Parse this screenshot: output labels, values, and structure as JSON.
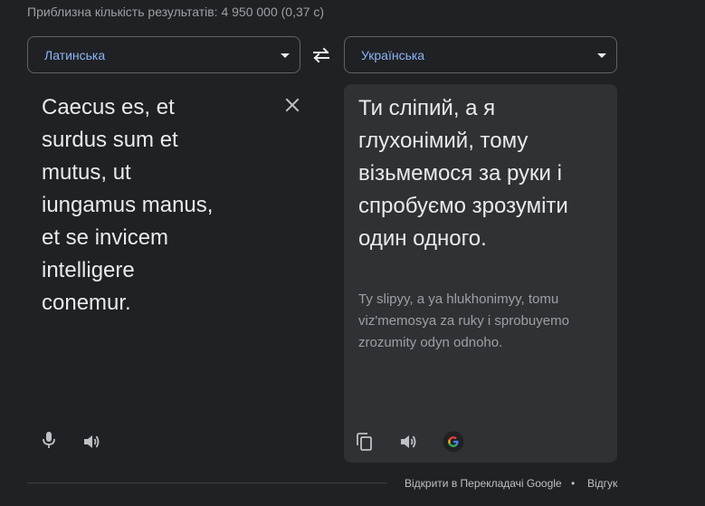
{
  "result_stats": "Приблизна кількість результатів: 4 950 000 (0,37 с)",
  "source_language": "Латинська",
  "target_language": "Українська",
  "source_text": "Caecus es, et surdus sum et mutus, ut iungamus manus, et se invicem intelligere conemur.",
  "translated_text": "Ти сліпий, а я глухонімий, тому візьмемося за руки і спробуємо зрозуміти один одного.",
  "transliteration": "Ty slipyy, a ya hlukhonimyy, tomu viz'memosya za ruky i sprobuyemo zrozumity odyn odnoho.",
  "footer": {
    "open_link": "Відкрити в Перекладачі Google",
    "separator": "•",
    "feedback": "Відгук"
  },
  "icons": {
    "swap": "swap-arrows-icon",
    "clear": "close-icon",
    "mic": "microphone-icon",
    "speaker": "speaker-icon",
    "copy": "copy-icon",
    "google": "google-logo-icon"
  },
  "colors": {
    "background": "#202124",
    "panel": "#303134",
    "accent": "#8ab4f8",
    "text": "#e8eaed",
    "muted": "#9aa0a6"
  }
}
